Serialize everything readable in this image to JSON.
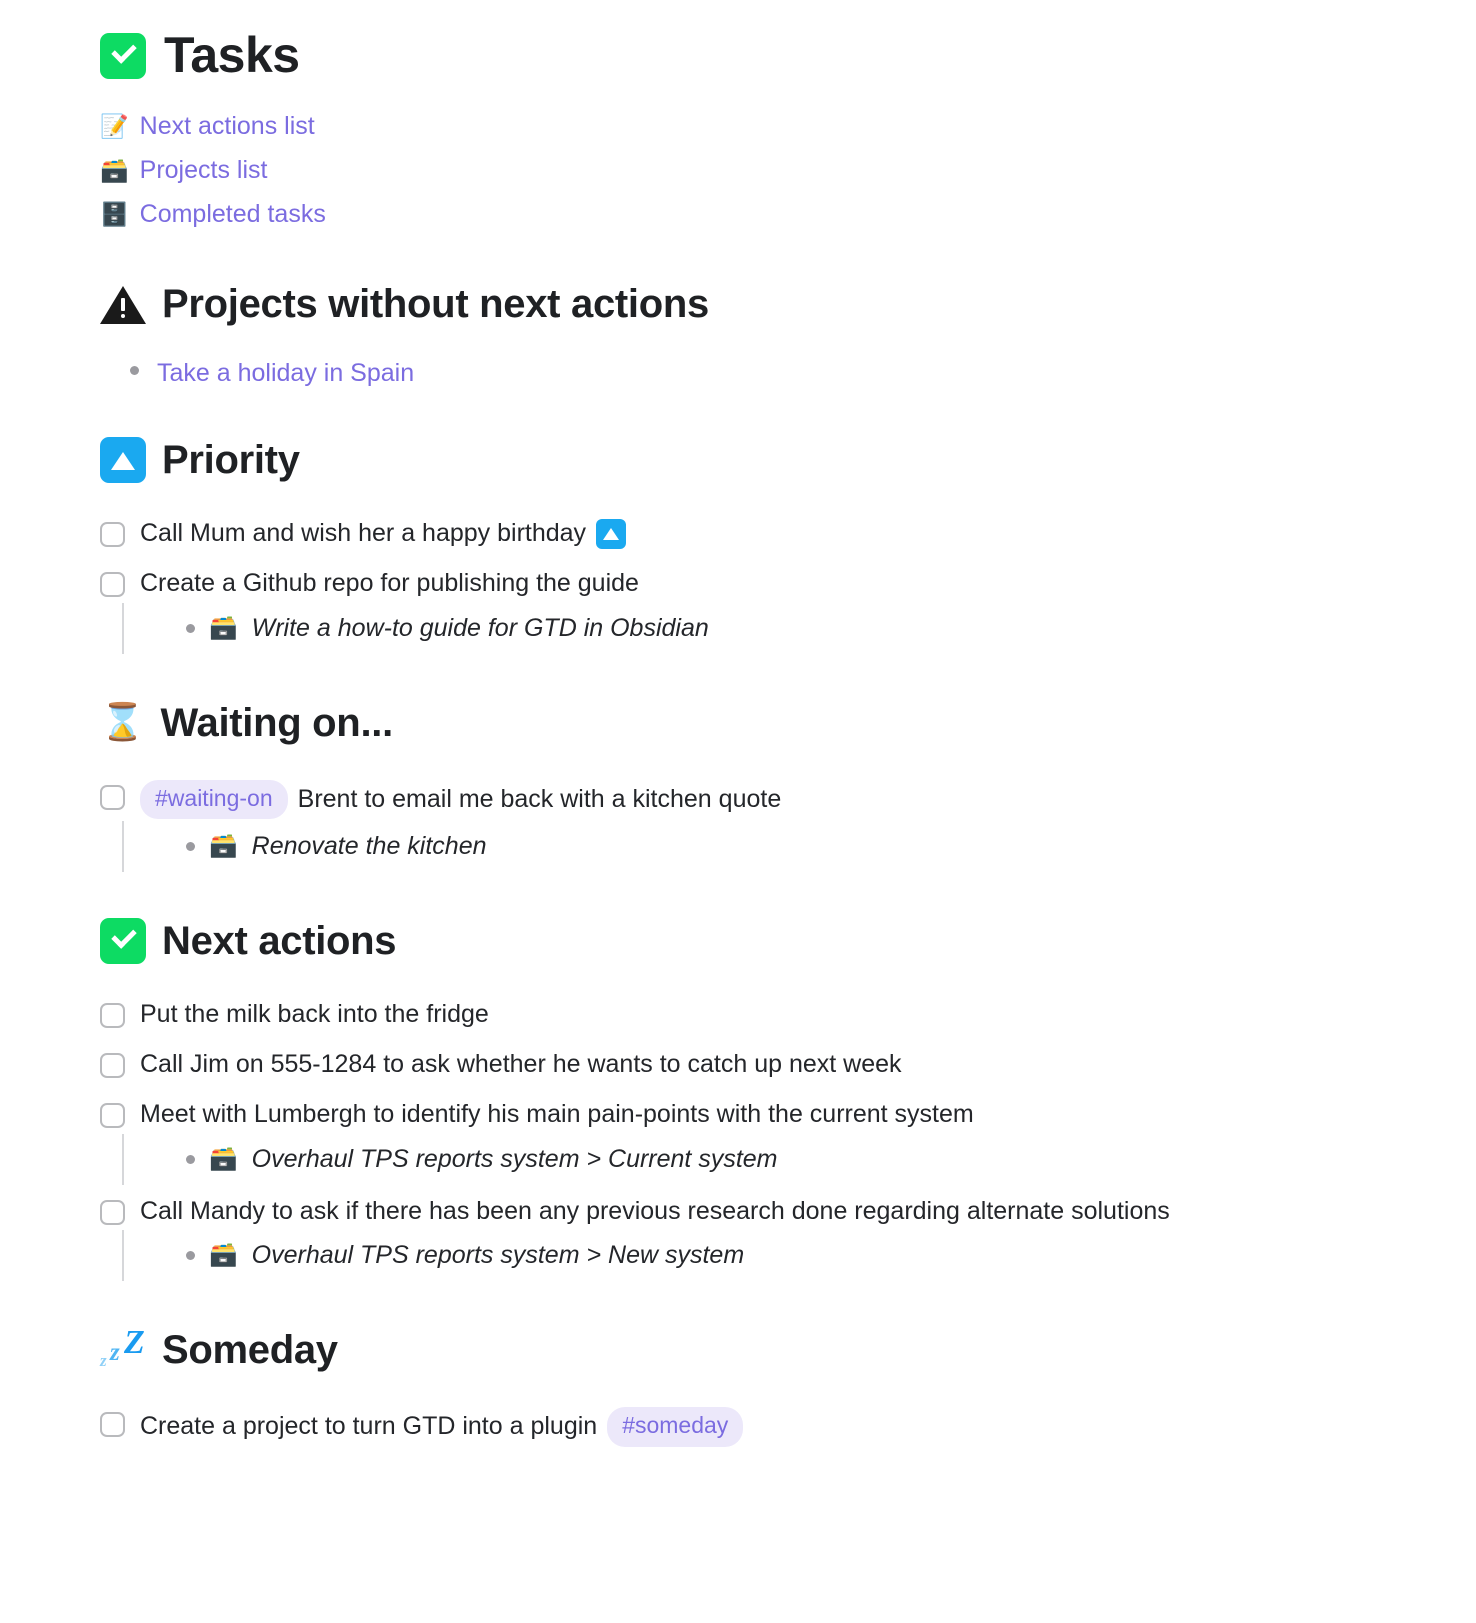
{
  "page": {
    "title": "Tasks",
    "title_icon": "white-check-mark-emoji"
  },
  "links": [
    {
      "icon": "memo-emoji",
      "glyph": "📝",
      "label": "Next actions list"
    },
    {
      "icon": "card-file-box-emoji",
      "glyph": "🗃️",
      "label": "Projects list"
    },
    {
      "icon": "file-cabinet-emoji",
      "glyph": "🗄️",
      "label": "Completed tasks"
    }
  ],
  "sections": {
    "projects_without_next_actions": {
      "heading": "Projects without next actions",
      "heading_icon": "warning-triangle-icon",
      "items": [
        {
          "label": "Take a holiday in Spain"
        }
      ]
    },
    "priority": {
      "heading": "Priority",
      "heading_icon": "blue-up-triangle-badge-icon",
      "tasks": [
        {
          "text": "Call Mum and wish her a happy birthday",
          "trailing_icon": "blue-up-triangle-badge-icon",
          "checked": false,
          "subref": null
        },
        {
          "text": "Create a Github repo for publishing the guide",
          "trailing_icon": null,
          "checked": false,
          "subref": {
            "glyph": "🗃️",
            "icon": "card-file-box-emoji",
            "label": "Write a how-to guide for GTD in Obsidian"
          }
        }
      ]
    },
    "waiting_on": {
      "heading": "Waiting on...",
      "heading_icon": "hourglass-emoji",
      "heading_glyph": "⌛",
      "tasks": [
        {
          "tag": "#waiting-on",
          "text": "Brent to email me back with a kitchen quote",
          "checked": false,
          "subref": {
            "glyph": "🗃️",
            "icon": "card-file-box-emoji",
            "label": "Renovate the kitchen"
          }
        }
      ]
    },
    "next_actions": {
      "heading": "Next actions",
      "heading_icon": "white-check-mark-emoji",
      "tasks": [
        {
          "text": "Put the milk back into the fridge",
          "checked": false,
          "subref": null
        },
        {
          "text": "Call Jim on 555-1284 to ask whether he wants to catch up next week",
          "checked": false,
          "subref": null
        },
        {
          "text": "Meet with Lumbergh to identify his main pain-points with the current system",
          "checked": false,
          "subref": {
            "glyph": "🗃️",
            "icon": "card-file-box-emoji",
            "label": "Overhaul TPS reports system > Current system"
          }
        },
        {
          "text": "Call Mandy to ask if there has been any previous research done regarding alternate solutions",
          "checked": false,
          "subref": {
            "glyph": "🗃️",
            "icon": "card-file-box-emoji",
            "label": "Overhaul TPS reports system > New system"
          }
        }
      ]
    },
    "someday": {
      "heading": "Someday",
      "heading_icon": "zzz-emoji",
      "tasks": [
        {
          "text": "Create a project to turn GTD into a plugin",
          "tag_after": "#someday",
          "checked": false,
          "subref": null
        }
      ]
    }
  },
  "colors": {
    "link": "#7b6ce0",
    "tag_text": "#7b6ce0",
    "tag_background": "#ece8fa",
    "green_badge": "#0ddb63",
    "blue_badge": "#1aa9f0",
    "text": "#24262a"
  }
}
